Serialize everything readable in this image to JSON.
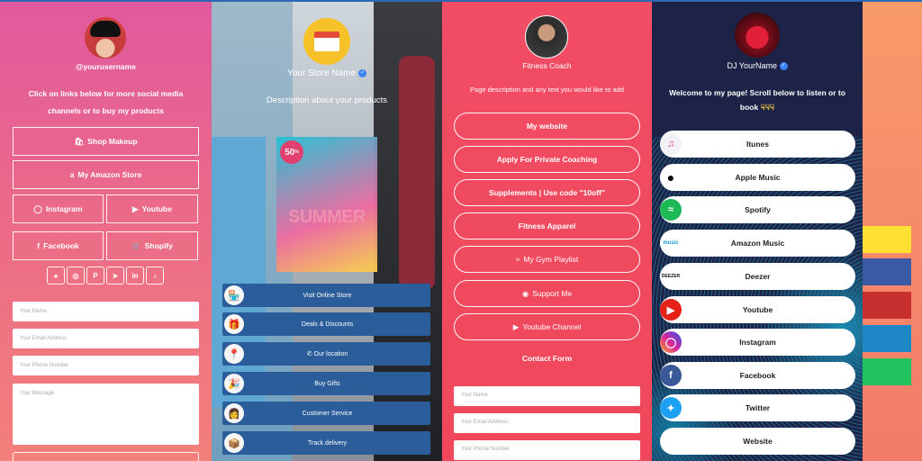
{
  "panel1": {
    "username": "@yourusername",
    "description": "Click on links below for more social media channels or to buy my products",
    "buttons": [
      {
        "label": "Shop Makeup",
        "icon": "shopping-bag-icon"
      },
      {
        "label": "My Amazon Store",
        "icon": "amazon-icon"
      }
    ],
    "half_buttons": [
      {
        "label": "Instagram",
        "icon": "instagram-icon"
      },
      {
        "label": "Youtube",
        "icon": "youtube-icon"
      },
      {
        "label": "Facebook",
        "icon": "facebook-icon"
      },
      {
        "label": "Shopify",
        "icon": "shopify-icon"
      }
    ],
    "social_icons": [
      "discord-icon",
      "dribbble-icon",
      "pinterest-icon",
      "telegram-icon",
      "linkedin-icon",
      "tiktok-icon"
    ],
    "form": {
      "name_placeholder": "Your Name",
      "email_placeholder": "Your Email Address",
      "phone_placeholder": "Your Phone Number",
      "message_placeholder": "Your Message"
    }
  },
  "panel2": {
    "store_name": "Your Store Name",
    "description": "Description about your products",
    "promo_badge": "50",
    "promo_text": "SUMMER",
    "links": [
      {
        "label": "Visit Online Store",
        "icon": "store-icon"
      },
      {
        "label": "Deals & Discounts",
        "icon": "gift-bag-icon"
      },
      {
        "label": "Our location",
        "icon": "location-icon"
      },
      {
        "label": "Buy Gifts",
        "icon": "gifts-icon"
      },
      {
        "label": "Customer Service",
        "icon": "support-agent-icon"
      },
      {
        "label": "Track delivery",
        "icon": "package-icon"
      }
    ]
  },
  "panel3": {
    "title": "Fitness Coach",
    "description": "Page description and any text you would like to add",
    "links": [
      {
        "label": "My website",
        "icon": ""
      },
      {
        "label": "Apply For Private Coaching",
        "icon": ""
      },
      {
        "label": "Supplements | Use code \"10off\"",
        "icon": ""
      },
      {
        "label": "Fitness Apparel",
        "icon": ""
      },
      {
        "label": "My Gym Playlist",
        "icon": "spotify-icon"
      },
      {
        "label": "Support Me",
        "icon": "patreon-icon"
      },
      {
        "label": "Youtube Channel",
        "icon": "youtube-icon"
      }
    ],
    "contact_title": "Contact Form",
    "form": {
      "name_placeholder": "Your Name",
      "email_placeholder": "Your Email Address",
      "phone_placeholder": "Your Phone Number"
    }
  },
  "panel4": {
    "name": "DJ YourName",
    "description": "Welcome to my page! Scroll below to listen or to book",
    "links": [
      {
        "label": "Itunes",
        "icon": "itunes-icon",
        "color": "#e7e7ee"
      },
      {
        "label": "Apple Music",
        "icon": "apple-icon",
        "color": "#ffffff"
      },
      {
        "label": "Spotify",
        "icon": "spotify-icon",
        "color": "#1db954"
      },
      {
        "label": "Amazon Music",
        "icon": "amazon-music-icon",
        "color": "#ffffff"
      },
      {
        "label": "Deezer",
        "icon": "deezer-icon",
        "color": "#ffffff"
      },
      {
        "label": "Youtube",
        "icon": "youtube-icon",
        "color": "#e62117"
      },
      {
        "label": "Instagram",
        "icon": "instagram-icon",
        "color": "#d6249f"
      },
      {
        "label": "Facebook",
        "icon": "facebook-icon",
        "color": "#3b5998"
      },
      {
        "label": "Twitter",
        "icon": "twitter-icon",
        "color": "#1da1f2"
      },
      {
        "label": "Website",
        "icon": "",
        "color": "#ffffff"
      }
    ]
  },
  "swatches": [
    "#ffe033",
    "#3b5aa6",
    "#c8302f",
    "#1e88c7",
    "#22c35e"
  ]
}
